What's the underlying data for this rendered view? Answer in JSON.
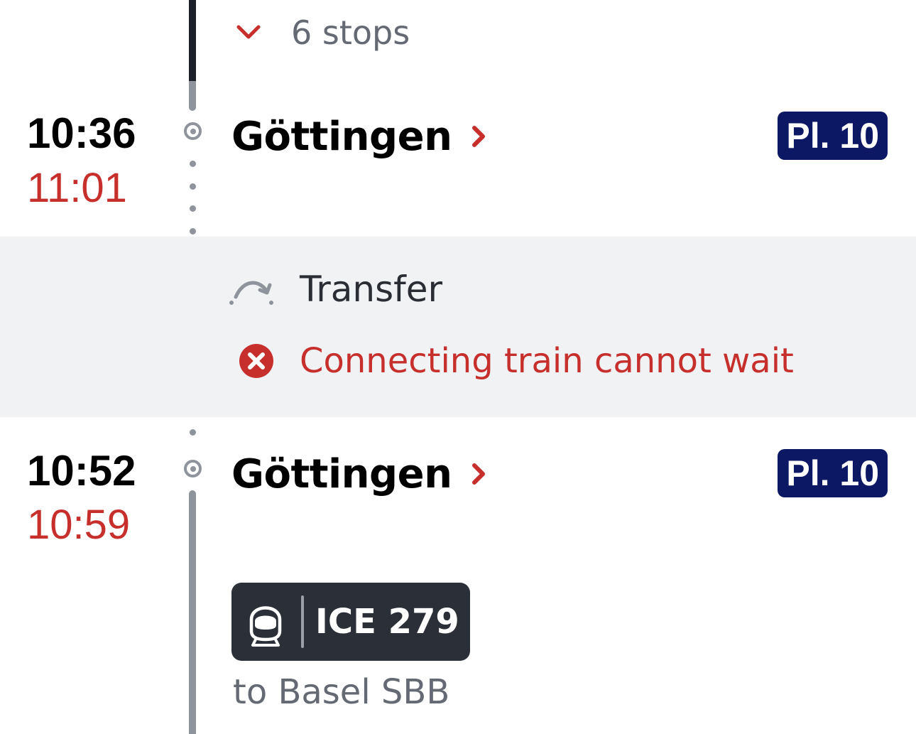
{
  "stops_toggle": {
    "label": "6 stops",
    "icon": "chevron-down-icon"
  },
  "arrival": {
    "scheduled": "10:36",
    "actual": "11:01",
    "station": "Göttingen",
    "platform": "Pl. 10"
  },
  "transfer": {
    "label": "Transfer",
    "warning": "Connecting train cannot wait"
  },
  "departure": {
    "scheduled": "10:52",
    "actual": "10:59",
    "station": "Göttingen",
    "platform": "Pl. 10",
    "train": "ICE 279",
    "destination": "to Basel SBB"
  },
  "colors": {
    "delay_red": "#c62f2b",
    "platform_blue": "#0c1863",
    "badge_dark": "#2a2f38",
    "muted_gray": "#646973",
    "transfer_bg": "#f1f2f4"
  }
}
